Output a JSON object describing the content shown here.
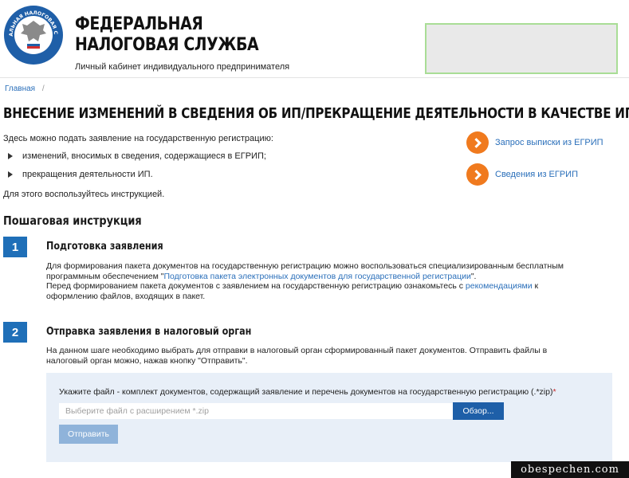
{
  "header": {
    "logo_text": "ФЕДЕРАЛЬНАЯ НАЛОГОВАЯ СЛУЖБА",
    "org_title_line1": "Федеральная",
    "org_title_line2": "налоговая служба",
    "subtitle": "Личный кабинет индивидуального предпринимателя"
  },
  "breadcrumb": {
    "home": "Главная",
    "separator": "/"
  },
  "page_title": "Внесение изменений в сведения об ИП/прекращение деятельности в качестве ИП",
  "intro": {
    "lead": "Здесь можно подать заявление на государственную регистрацию:",
    "bullets": [
      "изменений, вносимых в сведения, содержащиеся в ЕГРИП;",
      "прекращения деятельности ИП."
    ],
    "outro": "Для этого воспользуйтесь инструкцией."
  },
  "side_links": [
    {
      "label": "Запрос выписки из ЕГРИП"
    },
    {
      "label": "Сведения из ЕГРИП"
    }
  ],
  "instructions": {
    "heading": "Пошаговая инструкция",
    "steps": [
      {
        "number": "1",
        "title": "Подготовка заявления",
        "p1_before": "Для формирования пакета документов на государственную регистрацию можно воспользоваться специализированным бесплатным программным обеспечением \"",
        "p1_link": "Подготовка пакета электронных документов для государственной регистрации",
        "p1_after": "\".",
        "p2_before": "Перед формированием пакета документов с заявлением на государственную регистрацию ознакомьтесь с ",
        "p2_link": "рекомендациями",
        "p2_after": " к оформлению файлов, входящих в пакет."
      },
      {
        "number": "2",
        "title": "Отправка заявления в налоговый орган",
        "p1": "На данном шаге необходимо выбрать для отправки в налоговый орган сформированный пакет документов. Отправить файлы в налоговый орган можно, нажав кнопку \"Отправить\"."
      }
    ]
  },
  "upload": {
    "label": "Укажите файл - комплект документов, содержащий заявление и перечень документов на государственную регистрацию (.*zip)",
    "required_mark": "*",
    "placeholder": "Выберите файл с расширением *.zip",
    "browse_label": "Обзор...",
    "submit_label": "Отправить"
  },
  "watermark": "obespechen.com",
  "colors": {
    "accent_blue": "#1f6fb8",
    "link": "#2a6fba",
    "orange": "#f07a1e",
    "panel": "#e8eff8"
  }
}
